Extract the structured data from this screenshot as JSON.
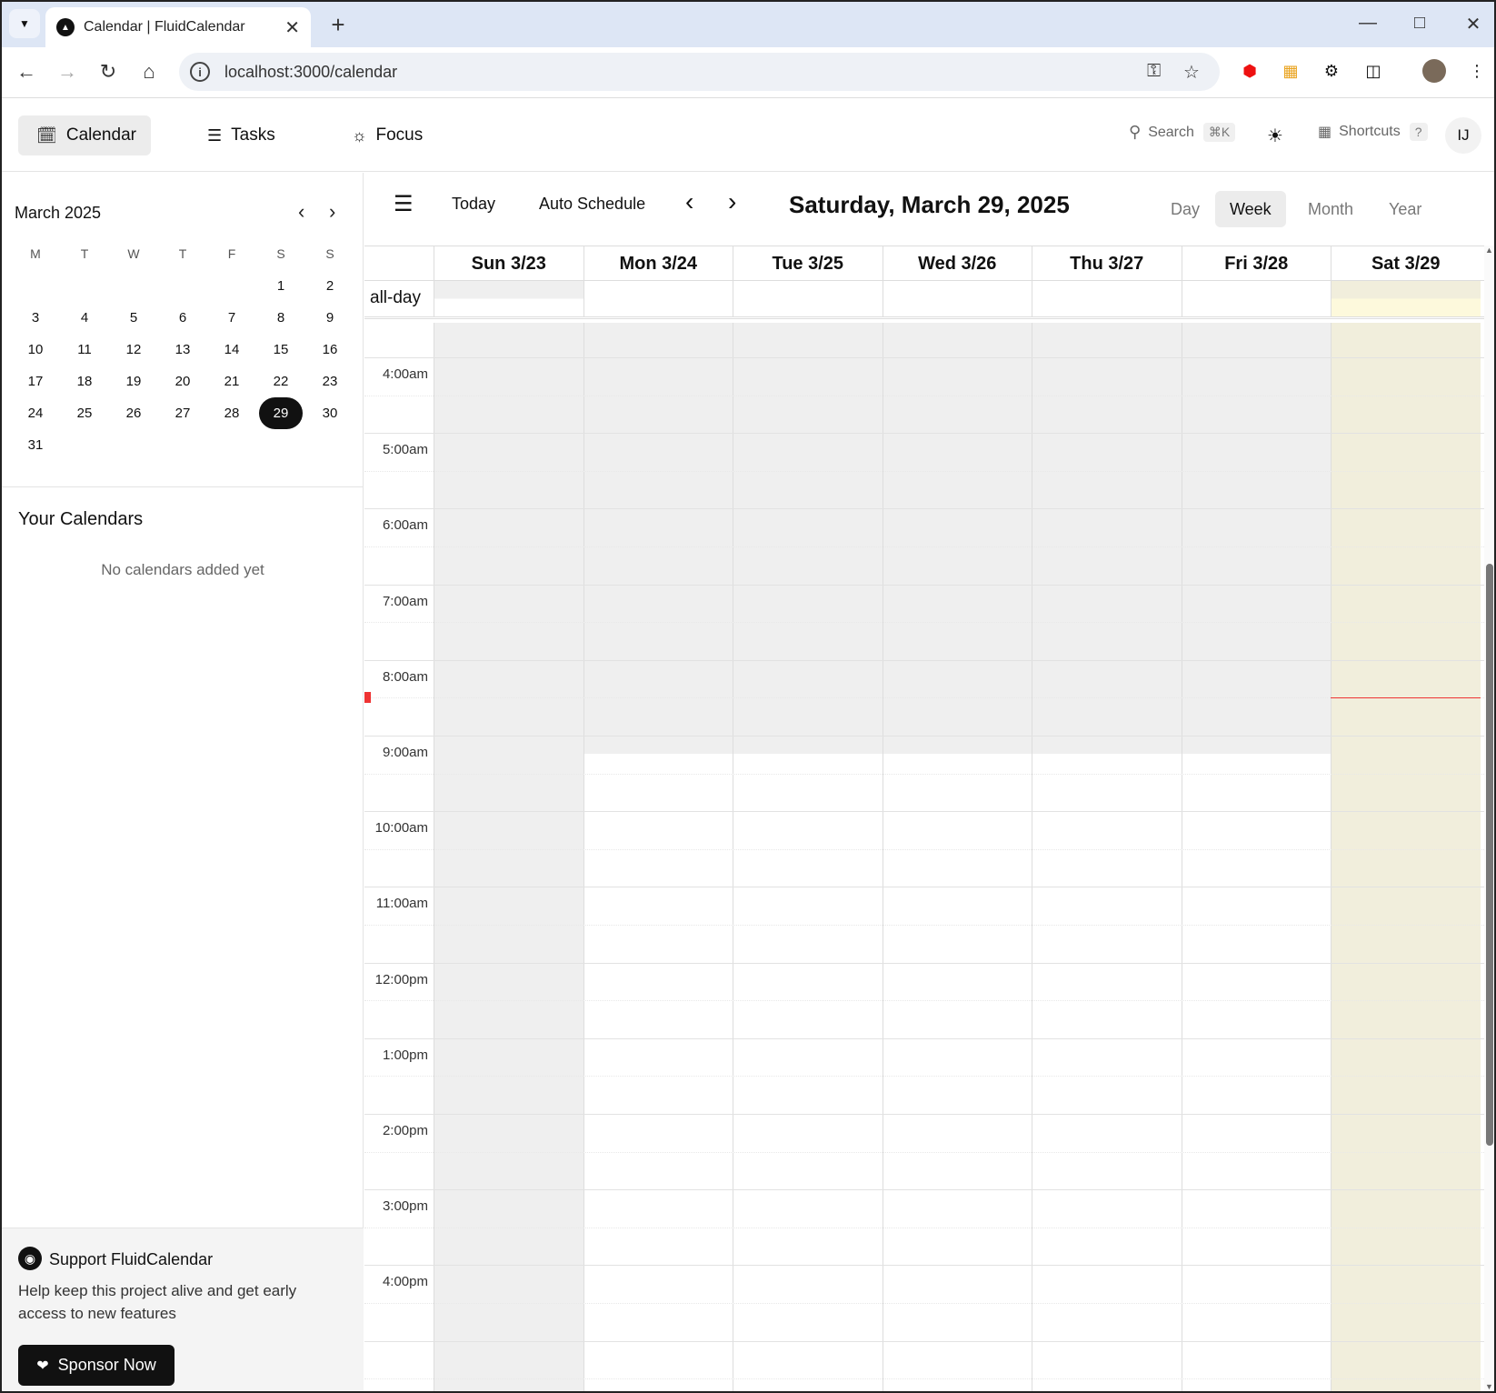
{
  "browser": {
    "tab_title": "Calendar | FluidCalendar",
    "url": "localhost:3000/calendar"
  },
  "nav": {
    "calendar": "Calendar",
    "tasks": "Tasks",
    "focus": "Focus",
    "search": "Search",
    "search_kbd": "⌘K",
    "shortcuts": "Shortcuts",
    "shortcuts_kbd": "?",
    "avatar": "IJ"
  },
  "mini_calendar": {
    "title": "March 2025",
    "weekdays": [
      "M",
      "T",
      "W",
      "T",
      "F",
      "S",
      "S"
    ],
    "weeks": [
      [
        "",
        "",
        "",
        "",
        "",
        "1",
        "2"
      ],
      [
        "3",
        "4",
        "5",
        "6",
        "7",
        "8",
        "9"
      ],
      [
        "10",
        "11",
        "12",
        "13",
        "14",
        "15",
        "16"
      ],
      [
        "17",
        "18",
        "19",
        "20",
        "21",
        "22",
        "23"
      ],
      [
        "24",
        "25",
        "26",
        "27",
        "28",
        "29",
        "30"
      ],
      [
        "31",
        "",
        "",
        "",
        "",
        "",
        ""
      ]
    ],
    "selected": "29"
  },
  "your_calendars": {
    "title": "Your Calendars",
    "empty": "No calendars added yet"
  },
  "support": {
    "title": "Support FluidCalendar",
    "text": "Help keep this project alive and get early access to new features",
    "button": "Sponsor Now"
  },
  "toolbar": {
    "today": "Today",
    "auto_schedule": "Auto Schedule",
    "title": "Saturday, March 29, 2025",
    "views": [
      "Day",
      "Week",
      "Month",
      "Year"
    ],
    "active_view": "Week"
  },
  "week": {
    "days": [
      "Sun 3/23",
      "Mon 3/24",
      "Tue 3/25",
      "Wed 3/26",
      "Thu 3/27",
      "Fri 3/28",
      "Sat 3/29"
    ],
    "all_day_label": "all-day",
    "times": [
      "4:00am",
      "5:00am",
      "6:00am",
      "7:00am",
      "8:00am",
      "9:00am",
      "10:00am",
      "11:00am",
      "12:00pm",
      "1:00pm",
      "2:00pm",
      "3:00pm",
      "4:00pm"
    ]
  },
  "colors": {
    "today_column": "#f1eedc",
    "offhours": "#efefef",
    "now_line": "#e33333"
  }
}
